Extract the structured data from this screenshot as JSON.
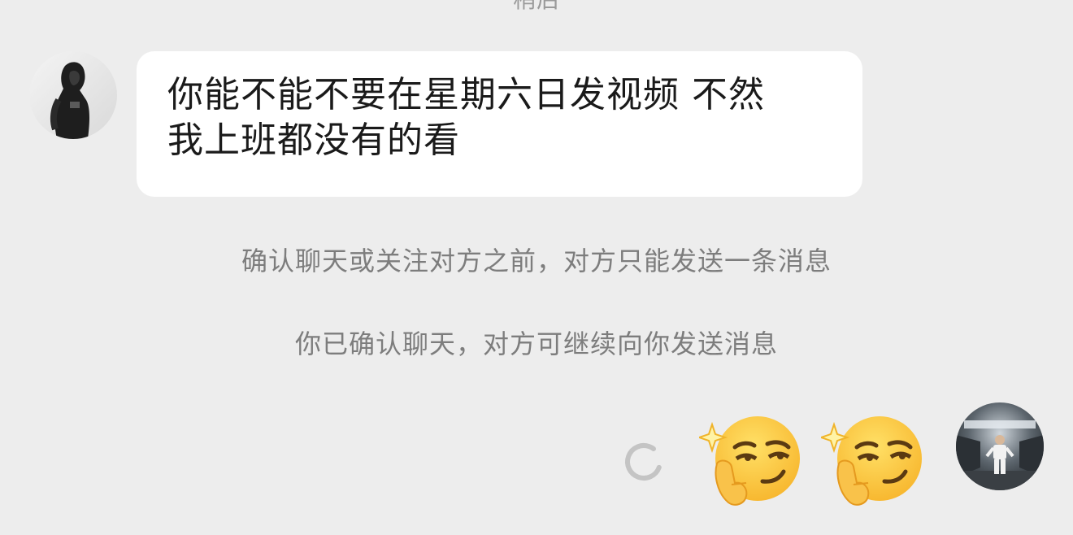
{
  "conversation": {
    "top_partial_text": "稍后",
    "incoming_message": {
      "line1": "你能不能不要在星期六日发视频 不然",
      "line2": "我上班都没有的看"
    },
    "system_notices": [
      "确认聊天或关注对方之前，对方只能发送一条消息",
      "你已确认聊天，对方可继续向你发送消息"
    ],
    "outgoing_message": {
      "content": [
        "thinking-sparkle-emoji",
        "thinking-sparkle-emoji"
      ],
      "status": "sending"
    }
  },
  "colors": {
    "background": "#ededed",
    "bubble": "#ffffff",
    "notice_text": "#7d7d7d",
    "message_text": "#1a1a1a"
  }
}
